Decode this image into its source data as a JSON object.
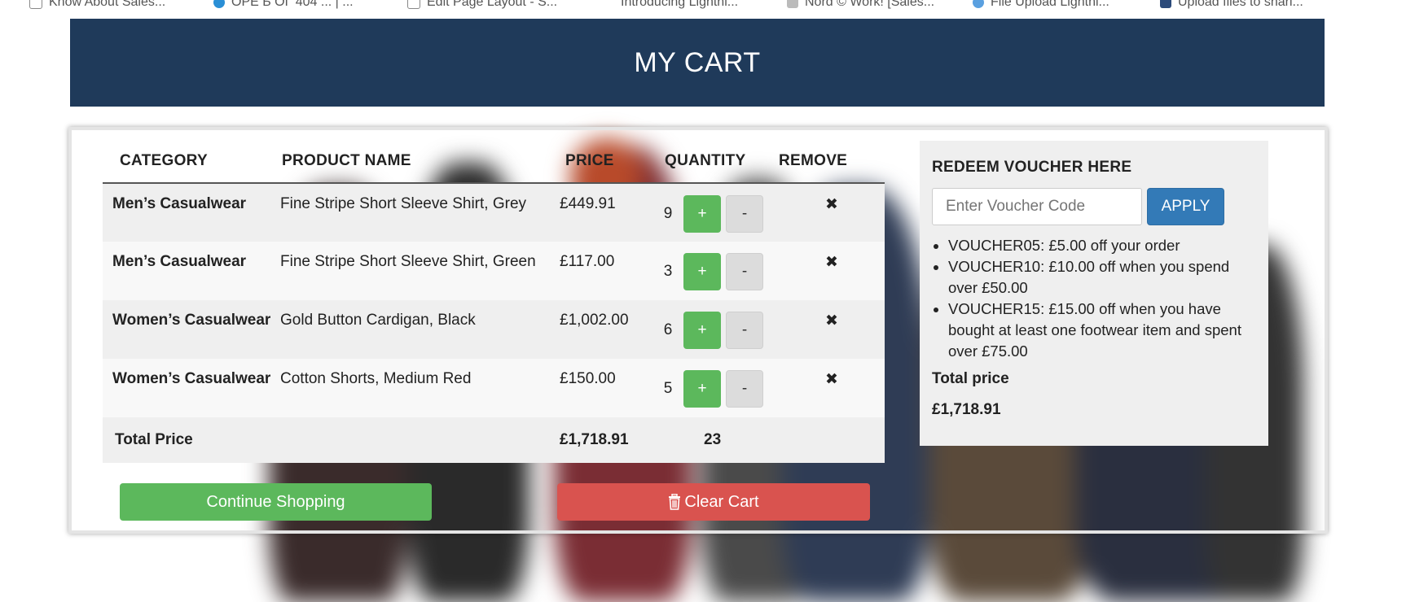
{
  "colors": {
    "header_bg": "#1f3a5a",
    "success": "#5cb85c",
    "danger": "#d9534f",
    "primary": "#337ab7"
  },
  "bookmarks": [
    {
      "label": "Know About Sales...",
      "icon": "page-icon"
    },
    {
      "label": "ОРЕ Б ОГ 404 ... | ...",
      "icon": "wordpress-icon"
    },
    {
      "label": "Edit Page Layout - S...",
      "icon": "page-icon"
    },
    {
      "label": "Introducing Lightni...",
      "icon": "page-icon"
    },
    {
      "label": "Nord © Work! [Sales...",
      "icon": "page-icon"
    },
    {
      "label": "File Upload Lightni...",
      "icon": "cloud-icon"
    },
    {
      "label": "Upload files to shari...",
      "icon": "page-icon"
    }
  ],
  "header": {
    "title": "MY CART"
  },
  "table": {
    "columns": [
      "CATEGORY",
      "PRODUCT NAME",
      "PRICE",
      "QUANTITY",
      "REMOVE"
    ],
    "rows": [
      {
        "category": "Men’s Casualwear",
        "name": "Fine Stripe Short Sleeve Shirt, Grey",
        "price": "£449.91",
        "qty": "9"
      },
      {
        "category": "Men’s Casualwear",
        "name": "Fine Stripe Short Sleeve Shirt, Green",
        "price": "£117.00",
        "qty": "3"
      },
      {
        "category": "Women’s Casualwear",
        "name": "Gold Button Cardigan, Black",
        "price": "£1,002.00",
        "qty": "6"
      },
      {
        "category": "Women’s Casualwear",
        "name": "Cotton Shorts, Medium Red",
        "price": "£150.00",
        "qty": "5"
      }
    ],
    "plus_label": "+",
    "minus_label": "-",
    "remove_glyph": "✖",
    "total": {
      "label": "Total Price",
      "price": "£1,718.91",
      "qty": "23"
    }
  },
  "buttons": {
    "continue": "Continue Shopping",
    "clear": "Clear Cart",
    "clear_icon": "trash-icon"
  },
  "voucher": {
    "title": "REDEEM VOUCHER HERE",
    "placeholder": "Enter Voucher Code",
    "apply": "APPLY",
    "offers": [
      "VOUCHER05: £5.00 off your order",
      "VOUCHER10: £10.00 off when you spend over £50.00",
      "VOUCHER15: £15.00 off when you have bought at least one footwear item and spent over £75.00"
    ],
    "total_label": "Total price",
    "total_value": "£1,718.91"
  }
}
